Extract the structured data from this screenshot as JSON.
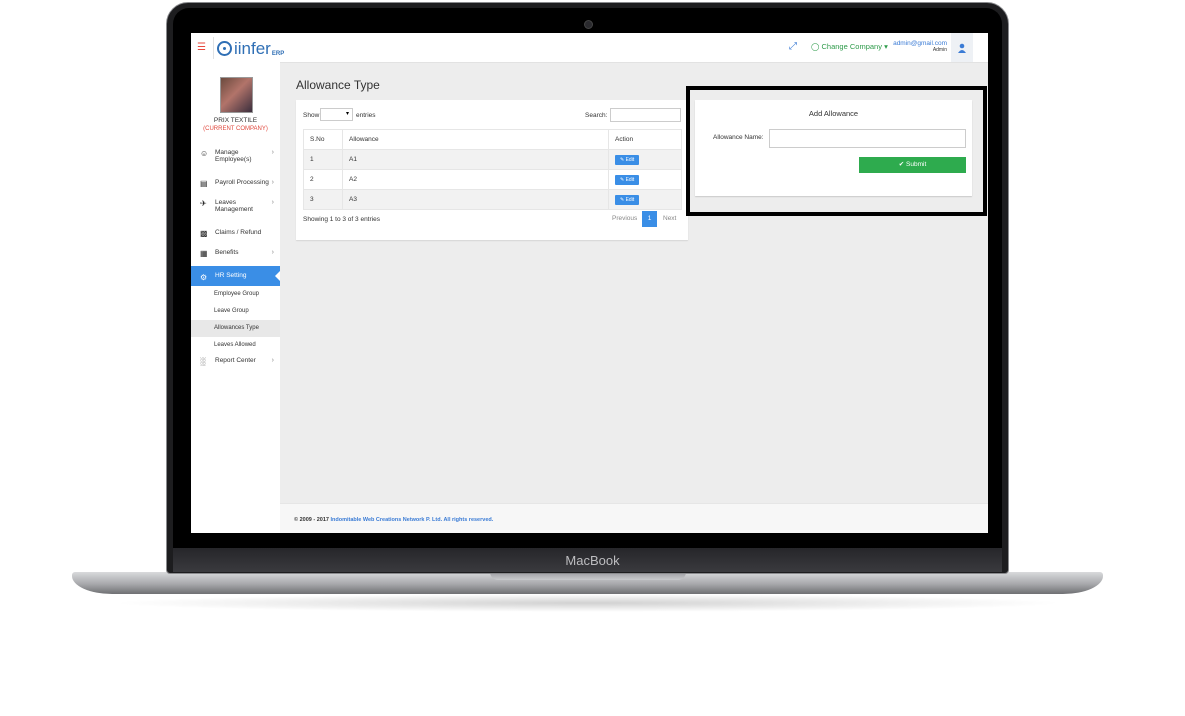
{
  "device": {
    "label": "MacBook"
  },
  "topbar": {
    "logo_text": "iinfer",
    "logo_suffix": "ERP",
    "change_company": "Change Company",
    "admin_email": "admin@gmail.com",
    "admin_role": "Admin"
  },
  "sidebar": {
    "company_name": "PRIX TEXTILE",
    "company_sub": "(CURRENT COMPANY)",
    "items": [
      {
        "label": "Manage Employee(s)",
        "icon": "user-icon"
      },
      {
        "label": "Payroll Processing",
        "icon": "payroll-icon"
      },
      {
        "label": "Leaves Management",
        "icon": "plane-icon"
      },
      {
        "label": "Claims / Refund",
        "icon": "money-icon"
      },
      {
        "label": "Benefits",
        "icon": "gift-icon"
      },
      {
        "label": "HR Setting",
        "icon": "gear-icon"
      },
      {
        "label": "Report Center",
        "icon": "bar-chart-icon"
      }
    ],
    "sub_items": [
      "Employee Group",
      "Leave Group",
      "Allowances Type",
      "Leaves Allowed"
    ]
  },
  "main": {
    "title": "Allowance Type",
    "table": {
      "show_label": "Show",
      "entries_label": "entries",
      "search_label": "Search:",
      "columns": [
        "S.No",
        "Allowance",
        "Action"
      ],
      "rows": [
        {
          "sno": "1",
          "allowance": "A1",
          "action": "Edit"
        },
        {
          "sno": "2",
          "allowance": "A2",
          "action": "Edit"
        },
        {
          "sno": "3",
          "allowance": "A3",
          "action": "Edit"
        }
      ],
      "showing": "Showing 1 to 3 of 3 entries",
      "prev": "Previous",
      "page": "1",
      "next": "Next"
    },
    "add_panel": {
      "title": "Add Allowance",
      "field_label": "Allowance Name:",
      "field_value": "",
      "submit": "Submit"
    }
  },
  "footer": {
    "prefix": "© 2009 - 2017 ",
    "company": "Indomitable Web Creations Network P. Ltd. All rights reserved."
  },
  "colors": {
    "accent": "#3a8ee6",
    "success": "#2eab4e",
    "danger": "#e0483d"
  }
}
